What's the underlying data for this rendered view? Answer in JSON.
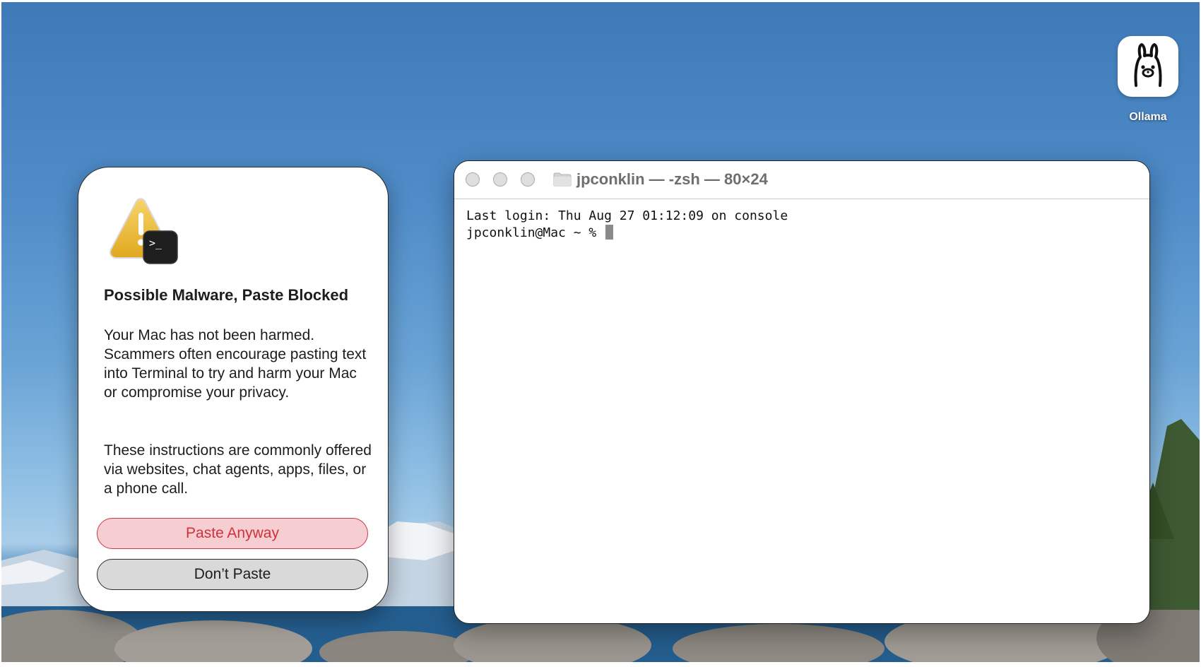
{
  "desktop": {
    "icon": {
      "name": "llama-icon",
      "label": "Ollama"
    }
  },
  "alert": {
    "title": "Possible Malware, Paste Blocked",
    "message1": "Your Mac has not been harmed. Scammers often encourage pasting text into Terminal to try and harm your Mac or compromise your privacy.",
    "message2": "These instructions are commonly offered via websites, chat agents, apps, files, or a phone call.",
    "paste_anyway_label": "Paste Anyway",
    "dont_paste_label": "Don’t Paste",
    "icon_glyph": ">_",
    "colors": {
      "destructive": "#d0313c",
      "destructive_bg": "#f6cdd0"
    }
  },
  "terminal": {
    "title": "jpconklin — -zsh — 80×24",
    "lines": {
      "last_login": "Last login: Thu Aug 27 01:12:09 on console",
      "prompt": "jpconklin@Mac ~ % "
    }
  }
}
